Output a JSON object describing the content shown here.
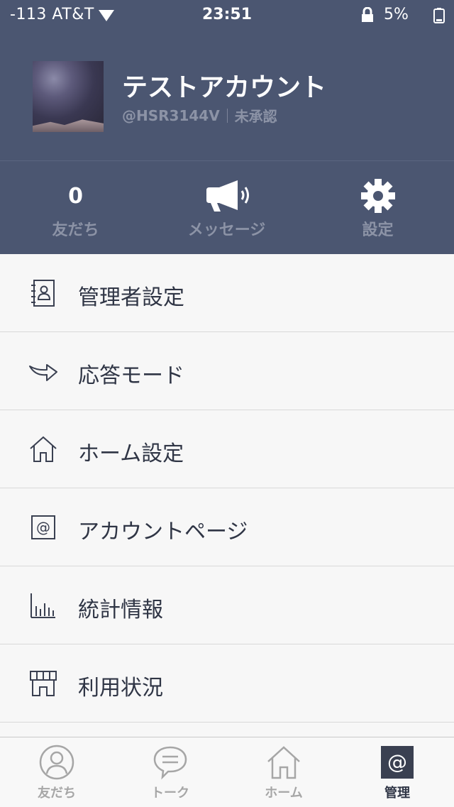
{
  "status_bar": {
    "carrier": "-113 AT&T",
    "time": "23:51",
    "battery": "5%"
  },
  "profile": {
    "name": "テストアカウント",
    "handle": "@HSR3144V",
    "verification": "未承認"
  },
  "stats": {
    "friends_count": "0",
    "friends_label": "友だち",
    "message_label": "メッセージ",
    "settings_label": "設定"
  },
  "menu": {
    "items": [
      {
        "label": "管理者設定",
        "icon": "admin-contact-icon"
      },
      {
        "label": "応答モード",
        "icon": "reply-arrow-icon"
      },
      {
        "label": "ホーム設定",
        "icon": "home-icon"
      },
      {
        "label": "アカウントページ",
        "icon": "at-sign-icon"
      },
      {
        "label": "統計情報",
        "icon": "bar-chart-icon"
      },
      {
        "label": "利用状況",
        "icon": "storefront-icon"
      }
    ]
  },
  "tabbar": {
    "tabs": [
      {
        "label": "友だち",
        "icon": "person-icon"
      },
      {
        "label": "トーク",
        "icon": "chat-bubble-icon"
      },
      {
        "label": "ホーム",
        "icon": "house-icon"
      },
      {
        "label": "管理",
        "icon": "at-sign-icon"
      }
    ],
    "active_index": 3
  },
  "colors": {
    "header_bg": "#4b5671",
    "muted_text": "#8c93a6",
    "menu_text": "#2f3545",
    "page_bg": "#f7f7f7"
  }
}
